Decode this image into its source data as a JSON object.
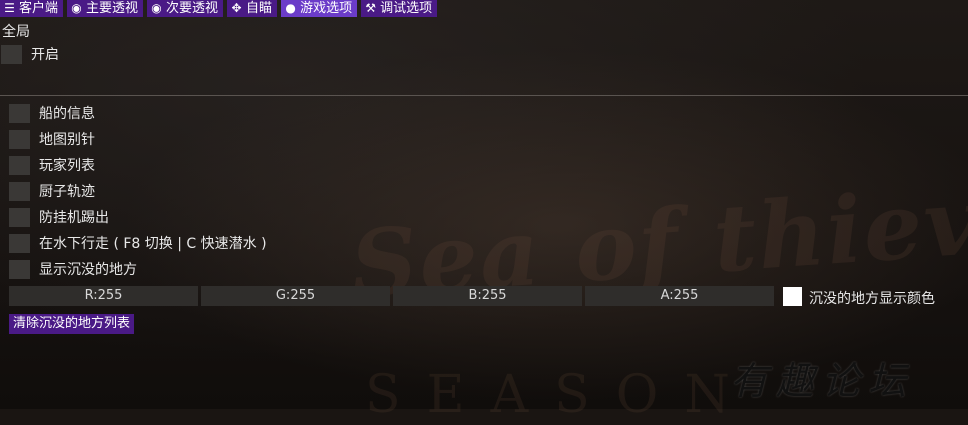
{
  "tabs": [
    {
      "label": "客户端",
      "icon": "sliders-icon",
      "glyph": "☰",
      "active": false
    },
    {
      "label": "主要透视",
      "icon": "eye-icon",
      "glyph": "◉",
      "active": false
    },
    {
      "label": "次要透视",
      "icon": "eye-icon",
      "glyph": "◉",
      "active": false
    },
    {
      "label": "自瞄",
      "icon": "crosshair-icon",
      "glyph": "✥",
      "active": false
    },
    {
      "label": "游戏选项",
      "icon": "globe-icon",
      "glyph": "●",
      "active": true
    },
    {
      "label": "调试选项",
      "icon": "wrench-icon",
      "glyph": "⚒",
      "active": false
    }
  ],
  "global": {
    "title": "全局",
    "enable_label": "开启"
  },
  "options": [
    {
      "label": "船的信息",
      "checked": false
    },
    {
      "label": "地图别针",
      "checked": false
    },
    {
      "label": "玩家列表",
      "checked": false
    },
    {
      "label": "厨子轨迹",
      "checked": false
    },
    {
      "label": "防挂机踢出",
      "checked": false
    },
    {
      "label": "在水下行走 ( F8 切换 | C 快速潜水 )",
      "checked": false
    },
    {
      "label": "显示沉没的地方",
      "checked": false
    }
  ],
  "color": {
    "r": "R:255",
    "g": "G:255",
    "b": "B:255",
    "a": "A:255",
    "swatch_hex": "#ffffff",
    "label": "沉没的地方显示颜色"
  },
  "clear_button": "清除沉没的地方列表",
  "background": {
    "logo": "Sea of thieves",
    "sub": "SEASON"
  },
  "watermark": "有趣论坛"
}
